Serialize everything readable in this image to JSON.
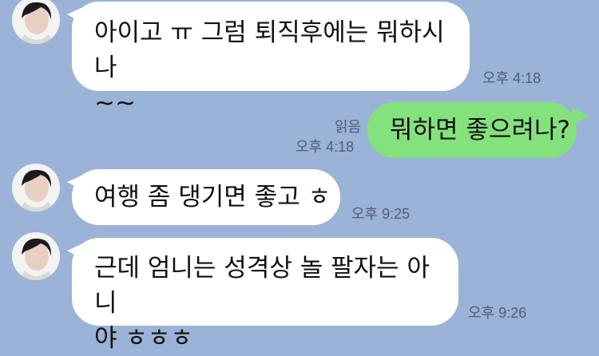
{
  "colors": {
    "background": "#9bb3d6",
    "incoming_bubble": "#ffffff",
    "outgoing_bubble": "#84e27d",
    "meta_text": "#4e5e78"
  },
  "messages": [
    {
      "direction": "incoming",
      "text": "아이고 ㅠ 그럼 퇴직후에는 뭐하시나\n~~",
      "time": "오후 4:18",
      "avatar_icon": "profile-photo"
    },
    {
      "direction": "outgoing",
      "text": "뭐하면 좋으려나?",
      "read_label": "읽음",
      "time": "오후 4:18"
    },
    {
      "direction": "incoming",
      "text": "여행 좀 댕기면 좋고 ㅎ",
      "time": "오후 9:25",
      "avatar_icon": "profile-photo"
    },
    {
      "direction": "incoming",
      "text": "근데 엄니는 성격상 놀 팔자는 아니\n야 ㅎㅎㅎ",
      "time": "오후 9:26",
      "avatar_icon": "profile-photo"
    }
  ]
}
